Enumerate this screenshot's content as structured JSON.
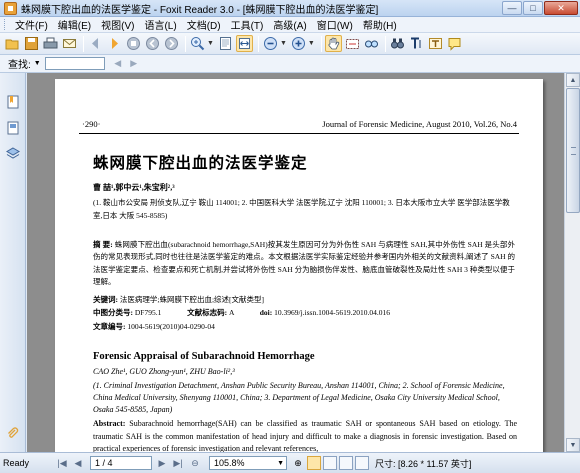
{
  "window": {
    "title": "蛛网膜下腔出血的法医学鉴定 - Foxit Reader 3.0 - [蛛网膜下腔出血的法医学鉴定]",
    "minimize": "—",
    "maximize": "□",
    "close": "✕"
  },
  "menu": [
    "文件(F)",
    "编辑(E)",
    "视图(V)",
    "语言(L)",
    "文档(D)",
    "工具(T)",
    "高级(A)",
    "窗口(W)",
    "帮助(H)"
  ],
  "find": {
    "label": "查找:",
    "placeholder": ""
  },
  "document": {
    "page_number": "·290·",
    "journal": "Journal of Forensic Medicine, August 2010, Vol.26, No.4",
    "title": "蛛网膜下腔出血的法医学鉴定",
    "authors": "曹 喆¹,郭中云¹,朱宝利²,³",
    "affiliation": "(1. 鞍山市公安局 刑侦支队,辽宁 鞍山 114001; 2. 中国医科大学 法医学院,辽宁 沈阳 110001; 3. 日本大阪市立大学 医学部法医学教室,日本 大阪 545-8585)",
    "abstract_label": "摘  要:",
    "abstract": "蛛网膜下腔出血(subarachnoid hemorrhage,SAH)按其发生原因可分为外伤性 SAH 与病理性 SAH,其中外伤性 SAH 是头部外伤的常见表现形式,同时也往往是法医学鉴定的难点。本文根据法医学实际鉴定经验并参考国内外相关的文献资料,阐述了 SAH 的法医学鉴定要点、检查要点和死亡机制,并尝试将外伤性 SAH 分为脑损伤伴发性、脑底血管破裂性及局灶性 SAH 3 种类型以便于理解。",
    "keywords_label": "关键词:",
    "keywords": "法医病理学;蛛网膜下腔出血;综述[文献类型]",
    "cls_label": "中图分类号:",
    "cls": "DF795.1",
    "doccode_label": "文献标志码:",
    "doccode": "A",
    "doi_label": "doi:",
    "doi": "10.3969/j.issn.1004-5619.2010.04.016",
    "article_label": "文章编号:",
    "article": "1004-5619(2010)04-0290-04",
    "en_title": "Forensic Appraisal of Subarachnoid Hemorrhage",
    "en_authors": "CAO Zhe¹, GUO Zhong-yun¹, ZHU Bao-li²,³",
    "en_affiliation": "(1. Criminal Investigation Detachment, Anshan Public Security Bureau, Anshan 114001, China; 2. School of Forensic Medicine, China Medical University, Shenyang 110001, China; 3. Department of Legal Medicine, Osaka City University Medical School, Osaka 545-8585, Japan)",
    "en_abstract_label": "Abstract:",
    "en_abstract": "Subarachnoid hemorrhage(SAH) can be classified as traumatic SAH or spontaneous SAH based on etiology. The traumatic SAH is the common manifestation of head injury and difficult to make a diagnosis in forensic investigation. Based on practical experiences of forensic investigation and relevant references,"
  },
  "status": {
    "ready": "Ready",
    "page": "1 / 4",
    "zoom": "105.8%",
    "size": "尺寸: [8.26 * 11.57 英寸]"
  },
  "colors": {
    "accent": "#f3a63a",
    "panel": "#dfe8f4",
    "workspace": "#8d8d8d"
  }
}
